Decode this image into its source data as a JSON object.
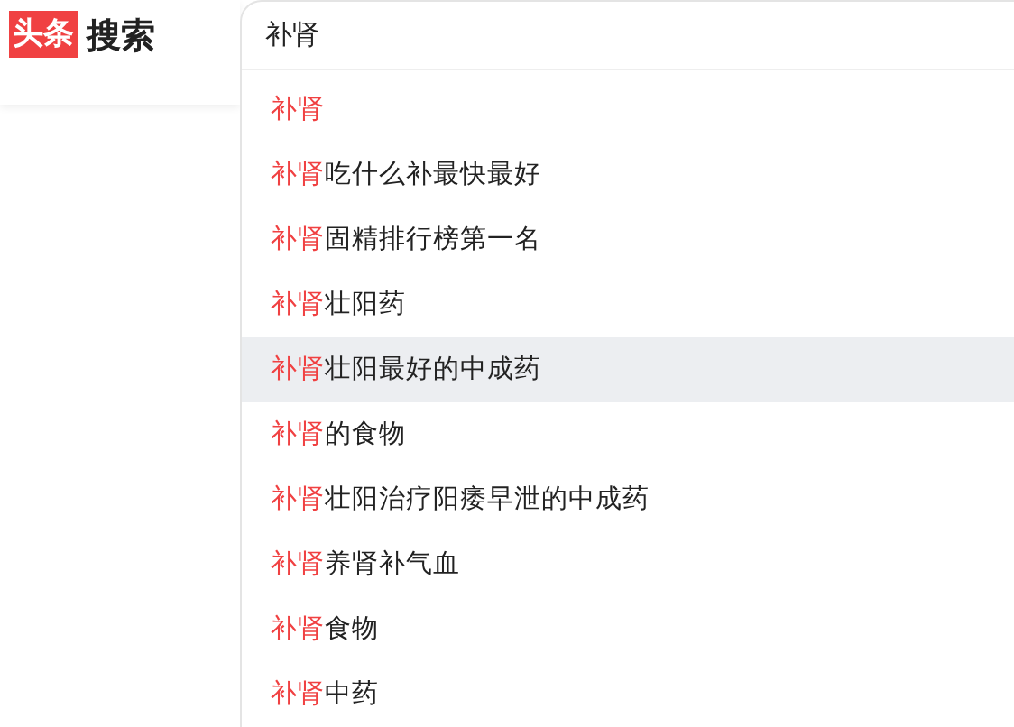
{
  "logo": {
    "badge": "头条",
    "text": "搜索"
  },
  "search": {
    "value": "补肾"
  },
  "suggestions": [
    {
      "match": "补肾",
      "selected": false
    },
    {
      "match": "补肾",
      "rest": "吃什么补最快最好",
      "selected": false
    },
    {
      "match": "补肾",
      "rest": "固精排行榜第一名",
      "selected": false
    },
    {
      "match": "补肾",
      "rest": "壮阳药",
      "selected": false
    },
    {
      "match": "补肾",
      "rest": "壮阳最好的中成药",
      "selected": true
    },
    {
      "match": "补肾",
      "rest": "的食物",
      "selected": false
    },
    {
      "match": "补肾",
      "rest": "壮阳治疗阳痿早泄的中成药",
      "selected": false
    },
    {
      "match": "补肾",
      "rest": "养肾补气血",
      "selected": false
    },
    {
      "match": "补肾",
      "rest": "食物",
      "selected": false
    },
    {
      "match": "补肾",
      "rest": "中药",
      "selected": false
    }
  ]
}
